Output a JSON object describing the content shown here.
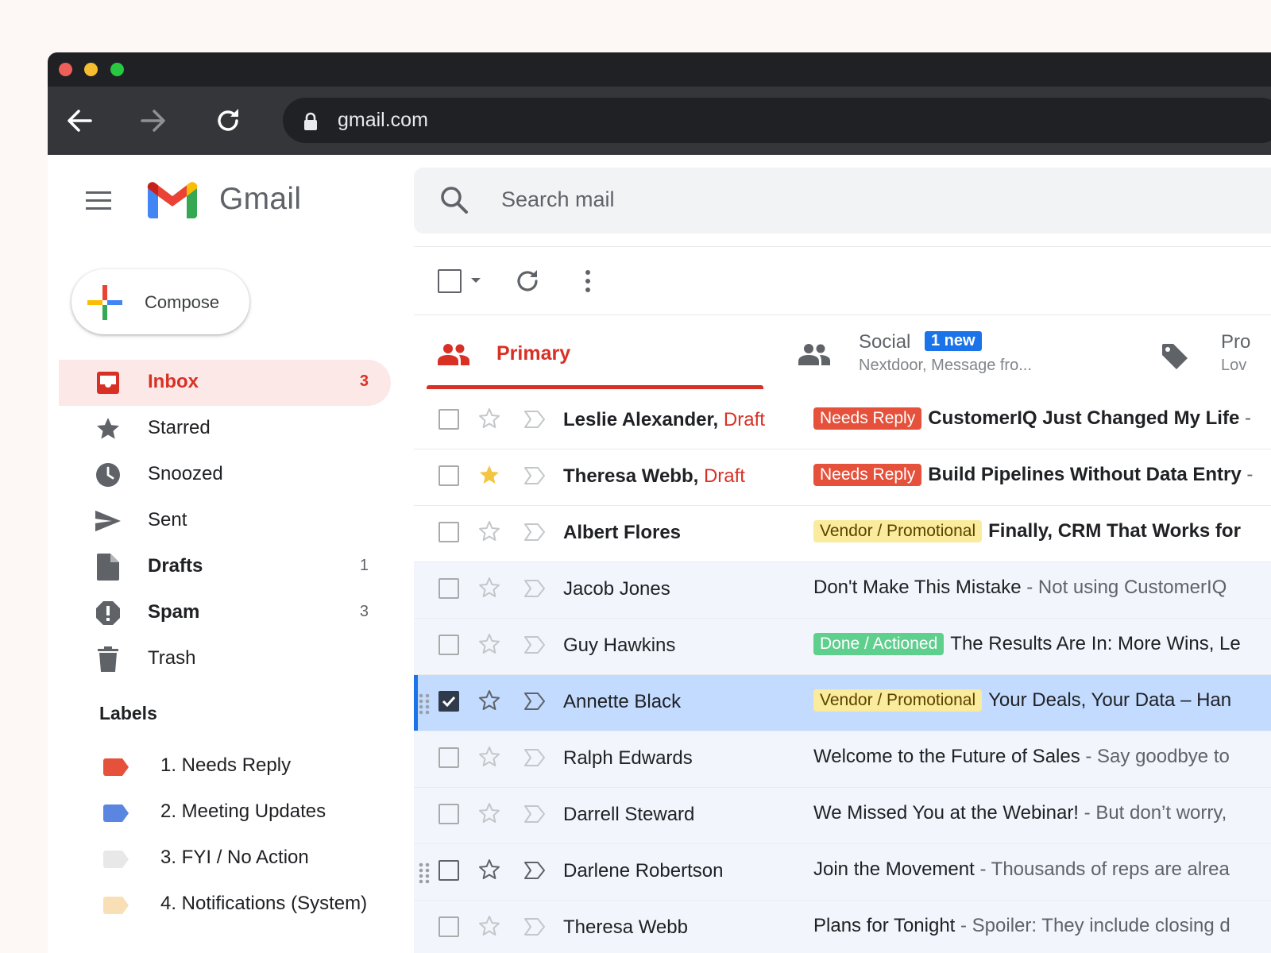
{
  "browser": {
    "url": "gmail.com",
    "traffic_colors": [
      "#ee5f57",
      "#f5bd2f",
      "#28c840"
    ]
  },
  "app": {
    "brand": "Gmail"
  },
  "compose": {
    "label": "Compose"
  },
  "search": {
    "placeholder": "Search mail"
  },
  "nav": [
    {
      "icon": "inbox-icon",
      "label": "Inbox",
      "count": "3",
      "active": true
    },
    {
      "icon": "star-icon",
      "label": "Starred",
      "count": ""
    },
    {
      "icon": "clock-icon",
      "label": "Snoozed",
      "count": ""
    },
    {
      "icon": "send-icon",
      "label": "Sent",
      "count": ""
    },
    {
      "icon": "file-icon",
      "label": "Drafts",
      "count": "1",
      "bold": true
    },
    {
      "icon": "spam-icon",
      "label": "Spam",
      "count": "3",
      "bold": true
    },
    {
      "icon": "trash-icon",
      "label": "Trash",
      "count": ""
    }
  ],
  "labels": {
    "heading": "Labels",
    "items": [
      {
        "name": "1. Needs Reply",
        "color": "#e5513b"
      },
      {
        "name": "2. Meeting Updates",
        "color": "#5a85e0"
      },
      {
        "name": "3. FYI / No Action",
        "color": "#e8e8e8"
      },
      {
        "name": "4. Notifications (System)",
        "color": "#f9dfb6"
      }
    ]
  },
  "tabs": {
    "primary": "Primary",
    "social": "Social",
    "social_badge": "1 new",
    "social_sub": "Nextdoor, Message fro...",
    "promotions": "Pro",
    "promotions_sub": "Lov"
  },
  "chip_colors": {
    "Needs Reply": {
      "bg": "#e5513b",
      "fg": "#ffffff"
    },
    "Vendor / Promotional": {
      "bg": "#fbeb9c",
      "fg": "#594300"
    },
    "Done / Actioned": {
      "bg": "#5fcf8e",
      "fg": "#ffffff"
    }
  },
  "emails": [
    {
      "sender": "Leslie Alexander,",
      "draft": "Draft",
      "chip": "Needs Reply",
      "subject": "CustomerIQ Just Changed My Life",
      "snippet": " -",
      "unread": true,
      "starred": false
    },
    {
      "sender": "Theresa Webb,",
      "draft": "Draft",
      "chip": "Needs Reply",
      "subject": "Build Pipelines Without Data Entry",
      "snippet": " -",
      "unread": true,
      "starred": true
    },
    {
      "sender": "Albert Flores",
      "draft": "",
      "chip": "Vendor / Promotional",
      "subject": "Finally, CRM That Works for",
      "snippet": "",
      "unread": true,
      "starred": false
    },
    {
      "sender": "Jacob Jones",
      "draft": "",
      "chip": "",
      "subject": "Don't Make This Mistake",
      "snippet": " - Not using CustomerIQ",
      "unread": false,
      "starred": false
    },
    {
      "sender": "Guy Hawkins",
      "draft": "",
      "chip": "Done / Actioned",
      "subject": "The Results Are In: More Wins, Le",
      "snippet": "",
      "unread": false,
      "starred": false
    },
    {
      "sender": "Annette Black",
      "draft": "",
      "chip": "Vendor / Promotional",
      "subject": "Your Deals, Your Data – Han",
      "snippet": "",
      "unread": false,
      "starred": false,
      "selected": true
    },
    {
      "sender": "Ralph Edwards",
      "draft": "",
      "chip": "",
      "subject": "Welcome to the Future of Sales",
      "snippet": " - Say goodbye to",
      "unread": false,
      "starred": false
    },
    {
      "sender": "Darrell Steward",
      "draft": "",
      "chip": "",
      "subject": "We Missed You at the Webinar!",
      "snippet": " - But don’t worry,",
      "unread": false,
      "starred": false
    },
    {
      "sender": "Darlene Robertson",
      "draft": "",
      "chip": "",
      "subject": "Join the Movement",
      "snippet": " - Thousands of reps are alrea",
      "unread": false,
      "starred": false,
      "hover": true
    },
    {
      "sender": "Theresa Webb",
      "draft": "",
      "chip": "",
      "subject": "Plans for Tonight",
      "snippet": " - Spoiler: They include closing d",
      "unread": false,
      "starred": false
    }
  ]
}
